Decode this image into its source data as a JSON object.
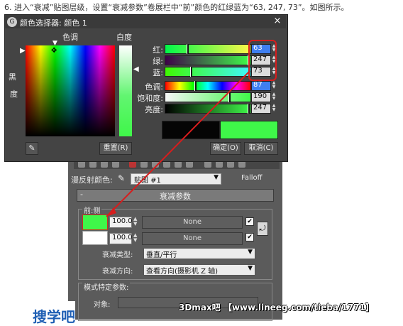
{
  "caption": "6. 进入“衰减”贴图层级，设置“衰减参数”卷展栏中“前”颜色的红绿蓝为“63, 247, 73”。如图所示。",
  "dialog": {
    "title": "颜色选择器: 颜色 1",
    "close_label": "×",
    "hue_label": "色调",
    "whiteness_label": "白度",
    "blackness_label_1": "黑",
    "blackness_label_2": "度",
    "rgb": [
      {
        "label": "红:",
        "value": "63",
        "fraction": 0.25
      },
      {
        "label": "绿:",
        "value": "247",
        "fraction": 0.97
      },
      {
        "label": "蓝:",
        "value": "73",
        "fraction": 0.29
      }
    ],
    "hsv": [
      {
        "label": "色调:",
        "value": "87",
        "fraction": 0.34
      },
      {
        "label": "饱和度:",
        "value": "190",
        "fraction": 0.74
      },
      {
        "label": "亮度:",
        "value": "247",
        "fraction": 0.97
      }
    ],
    "reset_label": "重置(R)",
    "ok_label": "确定(O)",
    "cancel_label": "取消(C)",
    "old_color": "#050505",
    "new_color": "#3ff749"
  },
  "max_panel": {
    "diffuse_label": "漫反射颜色:",
    "map_name": "贴图 #1",
    "map_type": "Falloff",
    "rollout_minus": "-",
    "rollout_title": "衰减参数",
    "front_side_title": "前:侧",
    "rows": [
      {
        "value": "100.0",
        "map": "None",
        "checked": "✔",
        "color": "#3ff749"
      },
      {
        "value": "100.0",
        "map": "None",
        "checked": "✔",
        "color": "#ffffff"
      }
    ],
    "falloff_type_label": "衰减类型:",
    "falloff_type_value": "垂直/平行",
    "falloff_dir_label": "衰减方向:",
    "falloff_dir_value": "查看方向(摄影机 Z 轴)",
    "mode_title": "模式特定参数:",
    "object_label": "对象:"
  },
  "watermarks": {
    "site": "3Dmax吧 【www.lineeg.com/tieba/1771】",
    "logo": "搜学吧"
  },
  "colors": {
    "accent_red": "#d61d1d",
    "target_green": "#3ff749"
  }
}
